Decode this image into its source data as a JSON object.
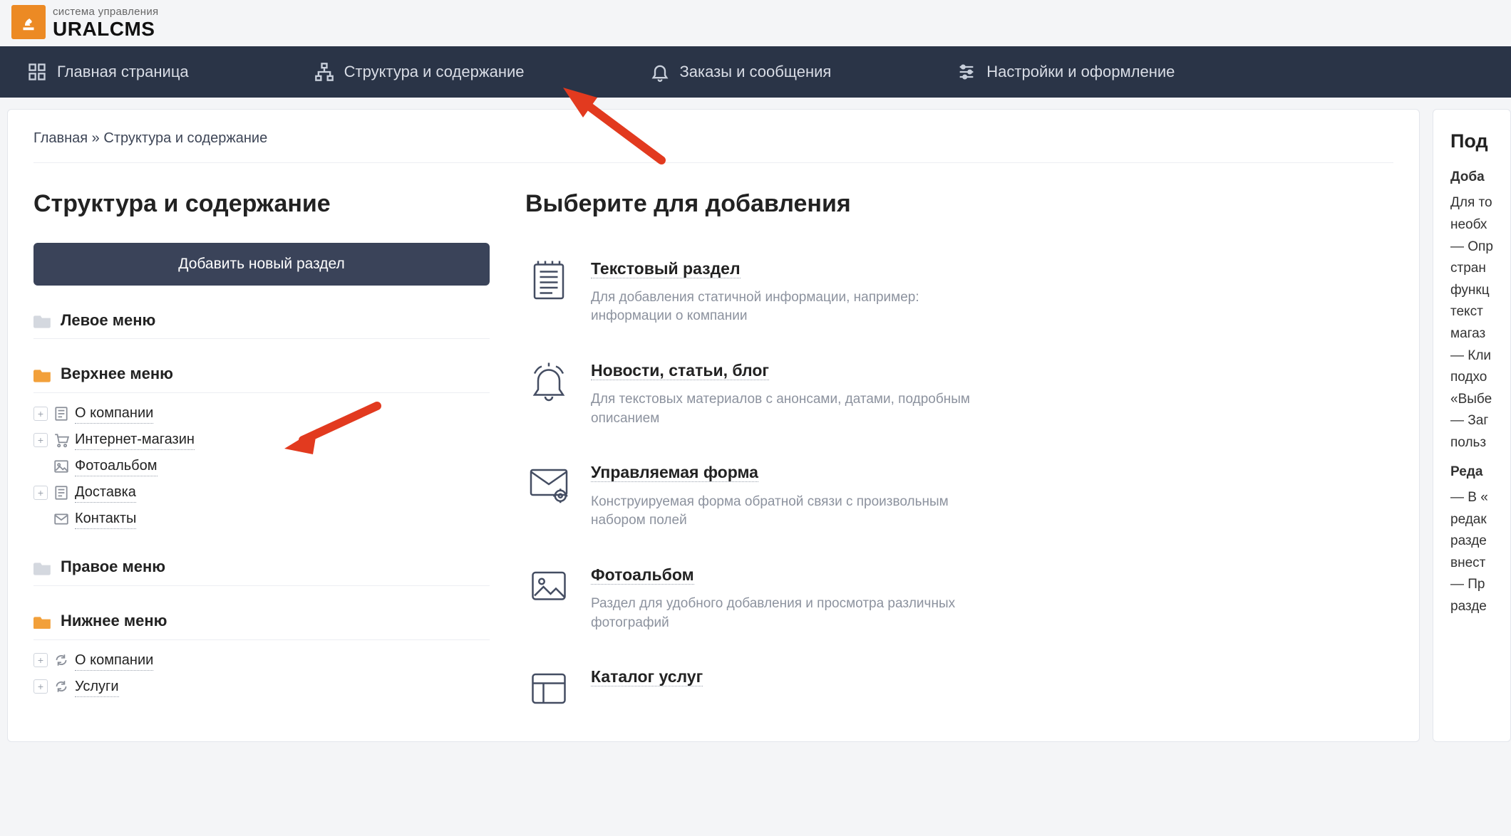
{
  "brand": {
    "sub": "система управления",
    "main": "URALCMS"
  },
  "nav": {
    "items": [
      {
        "label": "Главная страница",
        "icon": "grid"
      },
      {
        "label": "Структура и содержание",
        "icon": "sitemap"
      },
      {
        "label": "Заказы и сообщения",
        "icon": "bell"
      },
      {
        "label": "Настройки и оформление",
        "icon": "sliders"
      }
    ]
  },
  "breadcrumb": {
    "root": "Главная",
    "sep": " » ",
    "current": "Структура и содержание"
  },
  "left": {
    "title": "Структура и содержание",
    "add_button": "Добавить новый раздел",
    "menus": [
      {
        "name": "Левое меню",
        "state": "closed",
        "children": []
      },
      {
        "name": "Верхнее меню",
        "state": "open",
        "children": [
          {
            "label": "О компании",
            "icon": "doc"
          },
          {
            "label": "Интернет-магазин",
            "icon": "cart"
          },
          {
            "label": "Фотоальбом",
            "icon": "image"
          },
          {
            "label": "Доставка",
            "icon": "doc"
          },
          {
            "label": "Контакты",
            "icon": "mail"
          }
        ]
      },
      {
        "name": "Правое меню",
        "state": "closed",
        "children": []
      },
      {
        "name": "Нижнее меню",
        "state": "open",
        "children": [
          {
            "label": "О компании",
            "icon": "refresh"
          },
          {
            "label": "Услуги",
            "icon": "refresh"
          }
        ]
      }
    ]
  },
  "right": {
    "title": "Выберите для добавления",
    "options": [
      {
        "title": "Текстовый раздел",
        "desc": "Для добавления статичной информации, например: информации о компании",
        "icon": "notepad"
      },
      {
        "title": "Новости, статьи, блог",
        "desc": "Для текстовых материалов с анонсами, датами, подробным описанием",
        "icon": "bell-big"
      },
      {
        "title": "Управляемая форма",
        "desc": "Конструируемая форма обратной связи с произвольным набором полей",
        "icon": "envelope-gear"
      },
      {
        "title": "Фотоальбом",
        "desc": "Раздел для удобного добавления и просмотра различных фотографий",
        "icon": "picture"
      },
      {
        "title": "Каталог услуг",
        "desc": "",
        "icon": "catalog"
      }
    ]
  },
  "side": {
    "title": "Под",
    "h1": "Доба",
    "lines": [
      "Для то",
      "необх",
      "— Опр",
      "стран",
      "функц",
      "текст",
      "магаз",
      "— Кли",
      "подхо",
      "«Выбе",
      "— Заг",
      "польз"
    ],
    "h2": "Реда",
    "lines2": [
      "— В «",
      "редак",
      "разде",
      "внест",
      "— Пр",
      "разде"
    ]
  }
}
